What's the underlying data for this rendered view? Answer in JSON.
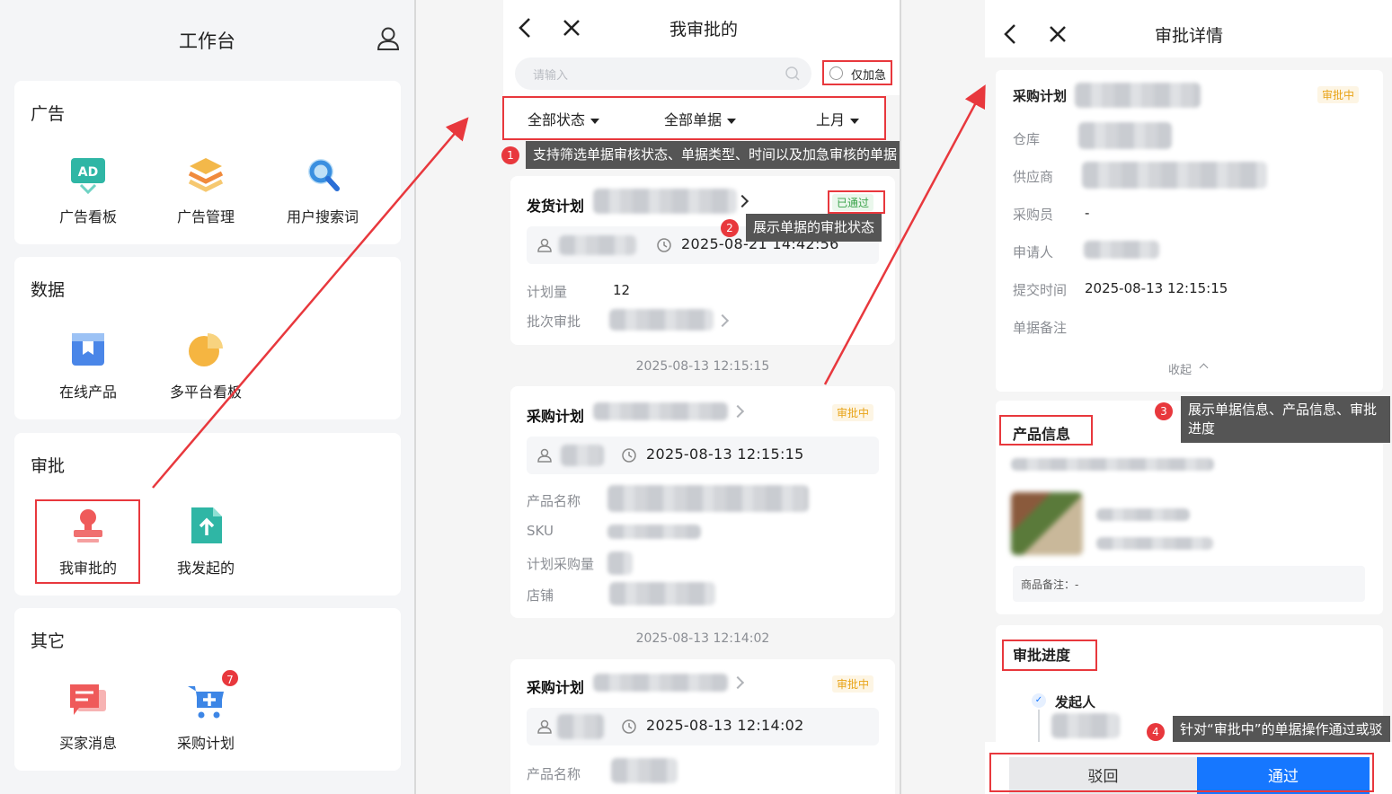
{
  "panel_workbench": {
    "title": "工作台",
    "sections": [
      {
        "title": "广告",
        "items": [
          {
            "label": "广告看板",
            "icon": "ad-board-icon"
          },
          {
            "label": "广告管理",
            "icon": "layers-icon"
          },
          {
            "label": "用户搜索词",
            "icon": "search-icon"
          }
        ]
      },
      {
        "title": "数据",
        "items": [
          {
            "label": "在线产品",
            "icon": "product-box-icon"
          },
          {
            "label": "多平台看板",
            "icon": "pie-chart-icon"
          }
        ]
      },
      {
        "title": "审批",
        "items": [
          {
            "label": "我审批的",
            "icon": "stamp-icon"
          },
          {
            "label": "我发起的",
            "icon": "upload-doc-icon"
          }
        ]
      },
      {
        "title": "其它",
        "items": [
          {
            "label": "买家消息",
            "icon": "message-icon"
          },
          {
            "label": "采购计划",
            "icon": "cart-icon",
            "badge": "7"
          }
        ]
      }
    ]
  },
  "panel_my_approvals": {
    "title": "我审批的",
    "search_placeholder": "请输入",
    "urgent_only_label": "仅加急",
    "filters": [
      "全部状态",
      "全部单据",
      "上月"
    ],
    "tooltip_1": {
      "num": "1",
      "text": "支持筛选单据审核状态、单据类型、时间以及加急审核的单据"
    },
    "tooltip_2": {
      "num": "2",
      "text": "展示单据的审批状态"
    },
    "list": [
      {
        "title": "发货计划",
        "status": "已通过",
        "time": "2025-08-21 14:42:56",
        "fields": [
          {
            "k": "计划量",
            "v": "12"
          },
          {
            "k": "批次审批",
            "v": ""
          }
        ]
      },
      {
        "date": "2025-08-13 12:15:15",
        "title": "采购计划",
        "status": "审批中",
        "time": "2025-08-13 12:15:15",
        "fields": [
          {
            "k": "产品名称",
            "v": ""
          },
          {
            "k": "SKU",
            "v": ""
          },
          {
            "k": "计划采购量",
            "v": ""
          },
          {
            "k": "店铺",
            "v": ""
          }
        ]
      },
      {
        "date": "2025-08-13 12:14:02",
        "title": "采购计划",
        "status": "审批中",
        "time": "2025-08-13 12:14:02",
        "fields": [
          {
            "k": "产品名称",
            "v": ""
          }
        ]
      }
    ]
  },
  "panel_detail": {
    "title": "审批详情",
    "doc_title": "采购计划",
    "status": "审批中",
    "fields": [
      {
        "k": "仓库",
        "v": ""
      },
      {
        "k": "供应商",
        "v": ""
      },
      {
        "k": "采购员",
        "v": "-"
      },
      {
        "k": "申请人",
        "v": ""
      },
      {
        "k": "提交时间",
        "v": "2025-08-13 12:15:15"
      },
      {
        "k": "单据备注",
        "v": ""
      }
    ],
    "collapse_label": "收起",
    "product_section_title": "产品信息",
    "product_note": "商品备注：-",
    "progress_section_title": "审批进度",
    "initiator_label": "发起人",
    "tooltip_3": {
      "num": "3",
      "text": "展示单据信息、产品信息、审批进度"
    },
    "tooltip_4": {
      "num": "4",
      "text": "针对“审批中”的单据操作通过或驳回"
    },
    "reject_label": "驳回",
    "approve_label": "通过"
  },
  "colors": {
    "accent": "#1677ff",
    "highlight": "#e8383d",
    "pass": "#3aa34a",
    "pending": "#e8a317"
  }
}
